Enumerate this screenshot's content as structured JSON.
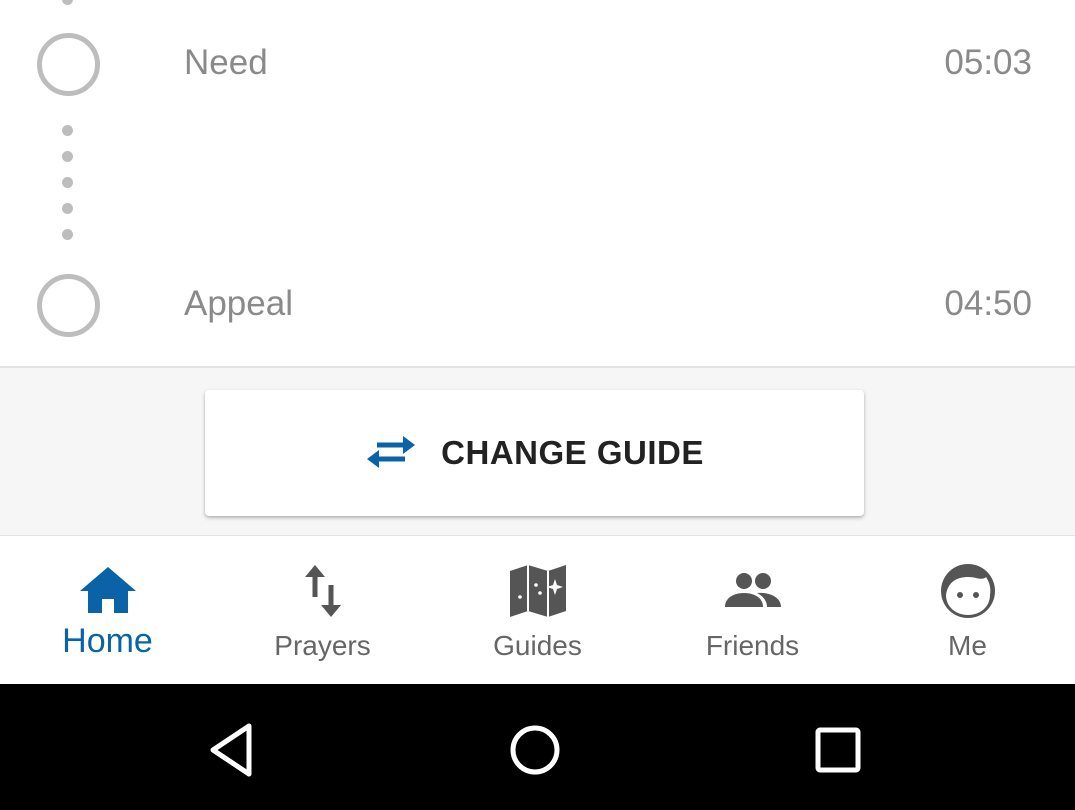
{
  "timeline": {
    "steps": [
      {
        "label": "Need",
        "time": "05:03"
      },
      {
        "label": "Appeal",
        "time": "04:50"
      }
    ]
  },
  "guide_action": {
    "label": "CHANGE GUIDE",
    "icon": "swap-horizontal-icon"
  },
  "bottom_nav": {
    "active": "Home",
    "items": [
      {
        "label": "Home",
        "icon": "home-icon"
      },
      {
        "label": "Prayers",
        "icon": "sort-arrows-icon"
      },
      {
        "label": "Guides",
        "icon": "map-icon"
      },
      {
        "label": "Friends",
        "icon": "people-icon"
      },
      {
        "label": "Me",
        "icon": "face-icon"
      }
    ]
  },
  "colors": {
    "accent": "#0a63a6",
    "inactive": "#666666",
    "step_circle": "#bdbdbd"
  },
  "system_nav": {
    "buttons": [
      "back-icon",
      "home-circle-icon",
      "recents-icon"
    ]
  }
}
